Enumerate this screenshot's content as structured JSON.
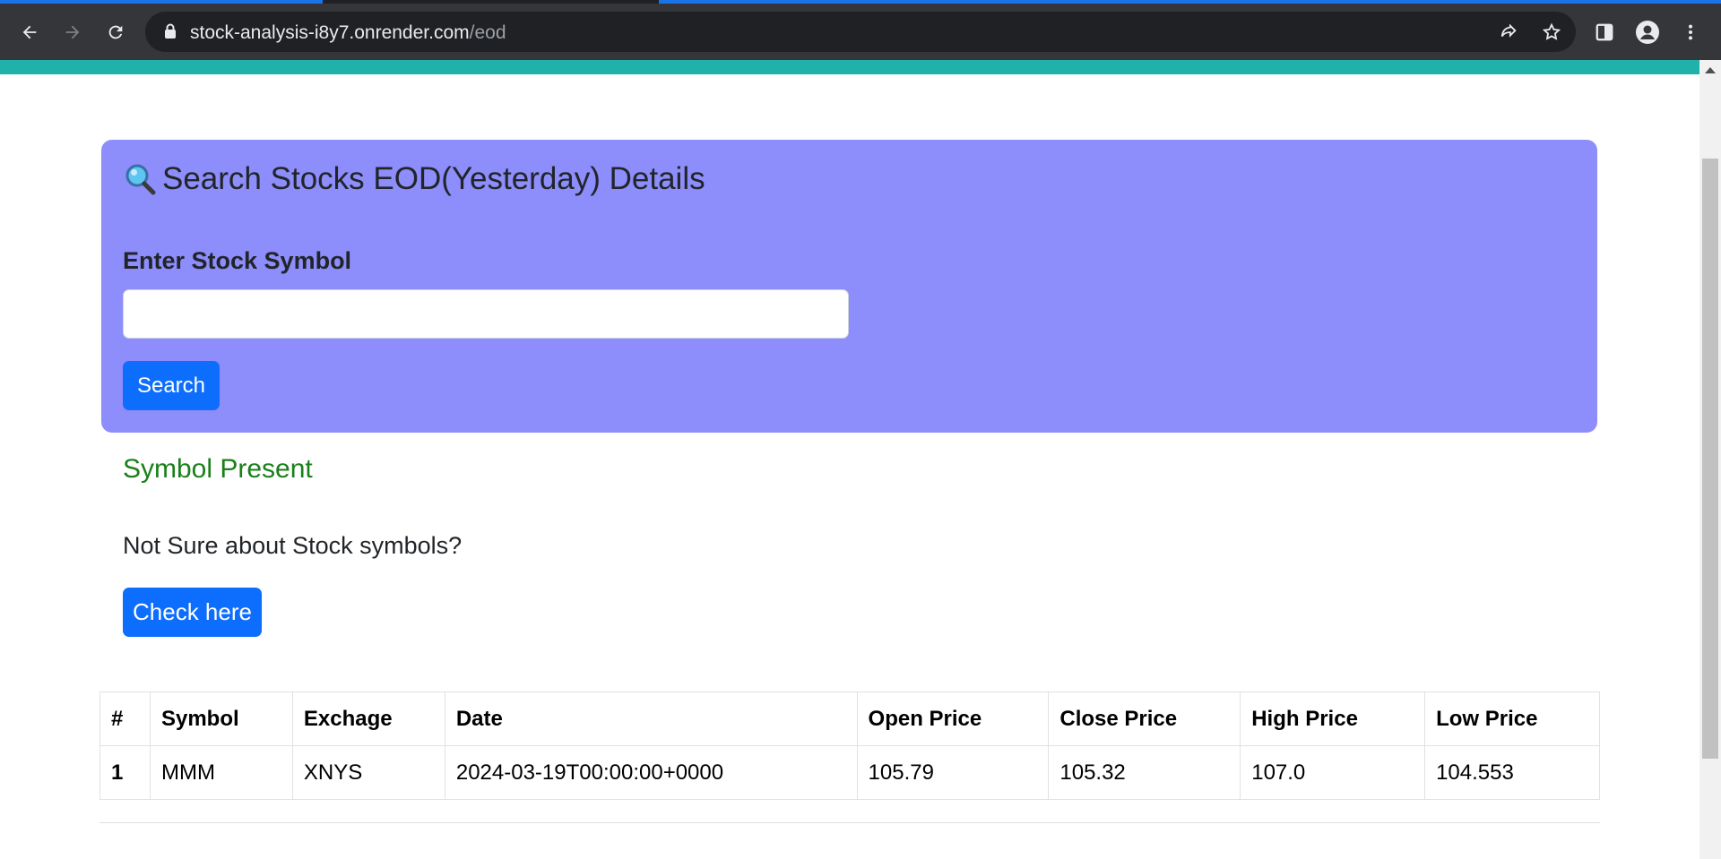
{
  "browser": {
    "url_host": "stock-analysis-i8y7.onrender.com",
    "url_path": "/eod"
  },
  "search": {
    "title": "Search Stocks EOD(Yesterday) Details",
    "title_icon": "magnifying-glass-icon",
    "input_label": "Enter Stock Symbol",
    "input_value": "",
    "button_label": "Search"
  },
  "status": {
    "message": "Symbol Present",
    "color": "#198019"
  },
  "help": {
    "text": "Not Sure about Stock symbols?",
    "button_label": "Check here"
  },
  "table": {
    "headers": [
      "#",
      "Symbol",
      "Exchage",
      "Date",
      "Open Price",
      "Close Price",
      "High Price",
      "Low Price"
    ],
    "rows": [
      [
        "1",
        "MMM",
        "XNYS",
        "2024-03-19T00:00:00+0000",
        "105.79",
        "105.32",
        "107.0",
        "104.553"
      ]
    ]
  },
  "colors": {
    "card_bg": "#8d8dfb",
    "accent_bar": "#20b2aa",
    "primary_button": "#0d6efd"
  }
}
